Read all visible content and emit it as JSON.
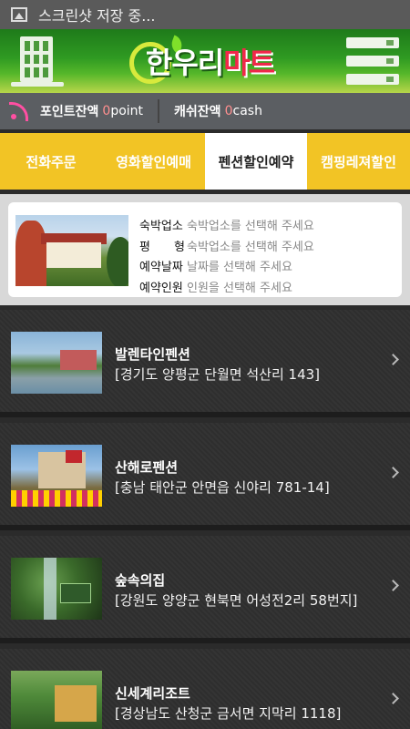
{
  "status_bar": {
    "text": "스크린샷 저장 중..."
  },
  "header": {
    "logo_main": "한우리",
    "logo_accent": "마트"
  },
  "balance": {
    "point_label": "포인트잔액",
    "point_value": "0",
    "point_unit": "point",
    "cash_label": "캐쉬잔액",
    "cash_value": "0",
    "cash_unit": "cash"
  },
  "tabs": [
    {
      "label": "전화주문",
      "active": false
    },
    {
      "label": "영화할인예매",
      "active": false
    },
    {
      "label": "펜션할인예약",
      "active": true
    },
    {
      "label": "캠핑레져할인",
      "active": false
    }
  ],
  "filter": {
    "rows": [
      {
        "key": "숙박업소",
        "value": "숙박업소를 선택해 주세요"
      },
      {
        "key": "평　　형",
        "value": "숙박업소를 선택해 주세요"
      },
      {
        "key": "예약날짜",
        "value": "날짜를 선택해 주세요"
      },
      {
        "key": "예약인원",
        "value": "인원을 선택해 주세요"
      }
    ]
  },
  "listings": [
    {
      "name": "발렌타인펜션",
      "address": "[경기도 양평군 단월면 석산리 143]"
    },
    {
      "name": "산해로펜션",
      "address": "[충남 태안군 안면읍 신야리 781-14]"
    },
    {
      "name": "숲속의집",
      "address": "[강원도 양양군 현북면 어성전2리 58번지]"
    },
    {
      "name": "신세계리조트",
      "address": "[경상남도 산청군 금서면 지막리 1118]"
    }
  ]
}
